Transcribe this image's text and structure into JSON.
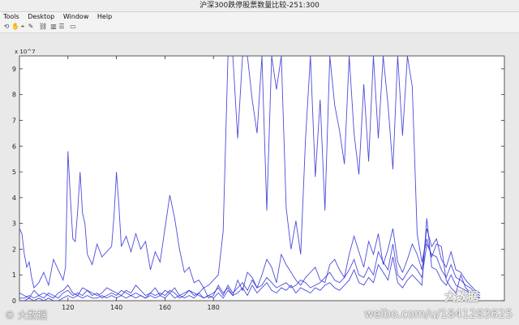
{
  "window": {
    "title": "沪深300跌停股票数量比较-251:300"
  },
  "menu": {
    "items": [
      "Tools",
      "Desktop",
      "Window",
      "Help"
    ]
  },
  "toolbar": {
    "icons": [
      "rotate-icon",
      "pan-icon",
      "datacursor-icon",
      "brush-icon",
      "link-icon",
      "colorbar-icon",
      "legend-icon",
      "hide-icon"
    ]
  },
  "colors": {
    "series": "#2b2bd6",
    "axes_bg": "#ffffff",
    "figure_bg": "#e9e9e9"
  },
  "chart_data": {
    "type": "line",
    "title": "",
    "xlabel": "",
    "ylabel": "",
    "y_scale_label": "x 10^7",
    "xlim": [
      100,
      300
    ],
    "ylim": [
      0,
      9.5
    ],
    "xticks": [
      120,
      140,
      160,
      180
    ],
    "xtick_labels": [
      "120",
      "140",
      "160",
      "180"
    ],
    "yticks": [
      0,
      1,
      2,
      3,
      4,
      5,
      6,
      7,
      8,
      9
    ],
    "ytick_labels": [
      "0",
      "1",
      "2",
      "3",
      "4",
      "5",
      "6",
      "7",
      "8",
      "9"
    ],
    "grid": false,
    "series": [
      {
        "x": [
          100,
          101,
          102,
          103,
          104,
          105,
          106,
          108,
          110,
          112,
          114,
          116,
          118,
          119,
          120,
          121,
          122,
          123,
          124,
          125,
          126,
          127,
          128,
          130,
          132,
          134,
          136,
          138,
          139,
          140,
          141,
          142,
          144,
          146,
          148,
          150,
          152,
          154,
          156,
          158,
          160,
          162,
          164,
          166,
          168,
          170,
          172,
          174,
          176,
          178,
          180,
          182,
          184,
          186,
          188,
          190,
          192,
          194,
          196,
          198,
          200,
          202,
          204,
          206,
          208,
          210,
          212,
          214,
          216,
          218,
          220,
          222,
          224,
          226,
          228,
          230,
          232,
          234,
          236,
          238,
          240,
          242,
          244,
          246,
          248,
          250,
          252,
          254,
          256,
          258,
          260,
          262,
          264,
          266,
          268,
          270,
          272,
          274,
          276,
          278,
          280,
          282,
          284,
          286,
          288,
          290
        ],
        "values": [
          2.8,
          2.6,
          1.8,
          1.3,
          1.5,
          0.9,
          0.5,
          0.7,
          1.1,
          0.6,
          1.6,
          1.2,
          0.8,
          1.3,
          5.8,
          4.0,
          2.4,
          2.3,
          3.5,
          5.0,
          3.4,
          3.0,
          1.8,
          1.4,
          2.2,
          1.7,
          1.9,
          2.1,
          3.3,
          5.0,
          3.7,
          2.1,
          2.5,
          1.9,
          2.6,
          2.0,
          2.3,
          1.2,
          1.9,
          1.5,
          2.8,
          4.1,
          3.2,
          2.0,
          1.1,
          1.3,
          0.7,
          0.8,
          0.5,
          0.6,
          0.8,
          1.0,
          2.7,
          9.5,
          9.5,
          6.3,
          9.5,
          9.5,
          7.8,
          6.5,
          9.5,
          3.5,
          9.5,
          8.2,
          9.5,
          3.6,
          2.0,
          3.1,
          1.8,
          6.3,
          9.5,
          4.8,
          7.8,
          3.5,
          9.5,
          7.6,
          6.6,
          5.3,
          9.5,
          6.5,
          4.9,
          8.4,
          5.4,
          9.5,
          6.3,
          9.5,
          7.6,
          5.1,
          9.5,
          6.4,
          9.5,
          8.3,
          2.6,
          1.5,
          2.4,
          1.7,
          2.2,
          2.1,
          0.8,
          0.5,
          0.3,
          1.0,
          0.5,
          0.3,
          0.2,
          0.1
        ]
      },
      {
        "x": [
          100,
          102,
          104,
          106,
          108,
          110,
          112,
          114,
          116,
          118,
          120,
          122,
          124,
          126,
          128,
          130,
          132,
          134,
          136,
          138,
          140,
          142,
          144,
          146,
          148,
          150,
          152,
          154,
          156,
          158,
          160,
          162,
          164,
          166,
          168,
          170,
          172,
          174,
          176,
          178,
          180,
          182,
          184,
          186,
          188,
          190,
          192,
          194,
          196,
          198,
          200,
          202,
          204,
          206,
          208,
          210,
          212,
          214,
          216,
          218,
          220,
          222,
          224,
          226,
          228,
          230,
          232,
          234,
          236,
          238,
          240,
          242,
          244,
          246,
          248,
          250,
          252,
          254,
          256,
          258,
          260,
          262,
          264,
          266,
          268,
          270,
          272,
          274,
          276,
          278,
          280,
          282,
          284,
          286,
          288,
          290
        ],
        "values": [
          0.3,
          0.2,
          0.1,
          0.4,
          0.2,
          0.3,
          0.2,
          0.1,
          0.3,
          0.4,
          0.6,
          0.3,
          0.2,
          0.5,
          0.4,
          0.3,
          0.2,
          0.3,
          0.5,
          0.4,
          0.3,
          0.2,
          0.4,
          0.3,
          0.6,
          0.4,
          0.2,
          0.3,
          0.5,
          0.2,
          0.4,
          0.3,
          0.5,
          0.2,
          0.3,
          0.4,
          0.2,
          0.3,
          0.5,
          0.1,
          0.2,
          0.6,
          0.3,
          0.5,
          0.2,
          0.8,
          0.4,
          1.1,
          0.9,
          0.5,
          1.0,
          1.6,
          1.3,
          0.7,
          1.8,
          1.4,
          1.1,
          0.8,
          0.6,
          0.9,
          1.1,
          1.3,
          0.8,
          0.7,
          1.4,
          1.6,
          1.2,
          0.9,
          1.8,
          2.5,
          1.9,
          1.3,
          2.3,
          1.8,
          2.6,
          1.4,
          2.0,
          2.8,
          1.5,
          1.1,
          1.6,
          2.2,
          1.8,
          1.2,
          2.8,
          2.1,
          2.4,
          1.6,
          1.3,
          1.9,
          1.2,
          1.1,
          0.8,
          0.6,
          0.4,
          0.3
        ]
      },
      {
        "x": [
          100,
          102,
          104,
          106,
          108,
          110,
          112,
          114,
          116,
          118,
          120,
          122,
          124,
          126,
          128,
          130,
          132,
          134,
          136,
          138,
          140,
          142,
          144,
          146,
          148,
          150,
          152,
          154,
          156,
          158,
          160,
          162,
          164,
          166,
          168,
          170,
          172,
          174,
          176,
          178,
          180,
          182,
          184,
          186,
          188,
          190,
          192,
          194,
          196,
          198,
          200,
          202,
          204,
          206,
          208,
          210,
          212,
          214,
          216,
          218,
          220,
          222,
          224,
          226,
          228,
          230,
          232,
          234,
          236,
          238,
          240,
          242,
          244,
          246,
          248,
          250,
          252,
          254,
          256,
          258,
          260,
          262,
          264,
          266,
          268,
          270,
          272,
          274,
          276,
          278,
          280,
          282,
          284,
          286,
          288,
          290
        ],
        "values": [
          0.1,
          0.1,
          0.2,
          0.1,
          0.2,
          0.1,
          0.3,
          0.2,
          0.1,
          0.3,
          0.4,
          0.2,
          0.3,
          0.2,
          0.4,
          0.2,
          0.3,
          0.1,
          0.2,
          0.3,
          0.2,
          0.4,
          0.3,
          0.2,
          0.3,
          0.2,
          0.1,
          0.3,
          0.2,
          0.3,
          0.2,
          0.4,
          0.3,
          0.1,
          0.2,
          0.4,
          0.3,
          0.2,
          0.1,
          0.2,
          0.3,
          0.5,
          0.2,
          0.6,
          0.3,
          0.5,
          0.7,
          0.4,
          0.8,
          0.5,
          0.6,
          0.9,
          0.7,
          0.5,
          0.6,
          0.7,
          0.5,
          0.6,
          0.8,
          0.7,
          0.5,
          0.6,
          0.7,
          0.9,
          1.1,
          0.8,
          0.7,
          0.9,
          1.2,
          1.6,
          1.0,
          0.9,
          1.3,
          1.0,
          1.9,
          1.5,
          1.2,
          2.2,
          1.0,
          0.8,
          1.1,
          1.4,
          1.2,
          0.9,
          2.2,
          1.8,
          1.7,
          1.2,
          0.9,
          1.4,
          0.9,
          0.8,
          0.6,
          0.5,
          0.3,
          0.2
        ]
      },
      {
        "x": [
          100,
          102,
          104,
          106,
          108,
          110,
          112,
          114,
          116,
          118,
          120,
          122,
          124,
          126,
          128,
          130,
          132,
          134,
          136,
          138,
          140,
          142,
          144,
          146,
          148,
          150,
          152,
          154,
          156,
          158,
          160,
          162,
          164,
          166,
          168,
          170,
          172,
          174,
          176,
          178,
          180,
          182,
          184,
          186,
          188,
          190,
          192,
          194,
          196,
          198,
          200,
          202,
          204,
          206,
          208,
          210,
          212,
          214,
          216,
          218,
          220,
          222,
          224,
          226,
          228,
          230,
          232,
          234,
          236,
          238,
          240,
          242,
          244,
          246,
          248,
          250,
          252,
          254,
          256,
          258,
          260,
          262,
          264,
          266,
          268,
          270,
          272,
          274,
          276,
          278,
          280,
          282,
          284,
          286,
          288,
          290
        ],
        "values": [
          0.0,
          0.0,
          0.1,
          0.0,
          0.1,
          0.0,
          0.1,
          0.0,
          0.0,
          0.1,
          0.2,
          0.1,
          0.2,
          0.1,
          0.2,
          0.1,
          0.1,
          0.2,
          0.1,
          0.2,
          0.1,
          0.2,
          0.1,
          0.2,
          0.1,
          0.2,
          0.1,
          0.2,
          0.1,
          0.2,
          0.1,
          0.3,
          0.1,
          0.2,
          0.1,
          0.2,
          0.1,
          0.3,
          0.1,
          0.2,
          0.1,
          0.3,
          0.1,
          0.4,
          0.2,
          0.3,
          0.5,
          0.2,
          0.6,
          0.3,
          0.5,
          0.7,
          0.4,
          0.3,
          0.5,
          0.4,
          0.6,
          0.3,
          0.5,
          0.4,
          0.3,
          0.5,
          0.4,
          0.6,
          0.7,
          0.5,
          0.4,
          0.6,
          0.8,
          1.2,
          0.7,
          0.6,
          0.9,
          0.7,
          1.4,
          1.1,
          0.8,
          1.7,
          0.7,
          0.5,
          0.8,
          1.0,
          0.8,
          0.6,
          3.2,
          1.3,
          1.2,
          0.8,
          0.6,
          1.0,
          0.6,
          0.5,
          0.4,
          0.3,
          0.2,
          0.1
        ]
      }
    ]
  },
  "watermarks": {
    "left": "© 大数据",
    "right": "weibo.com/u/1841283625",
    "right_brand": "大数据"
  }
}
